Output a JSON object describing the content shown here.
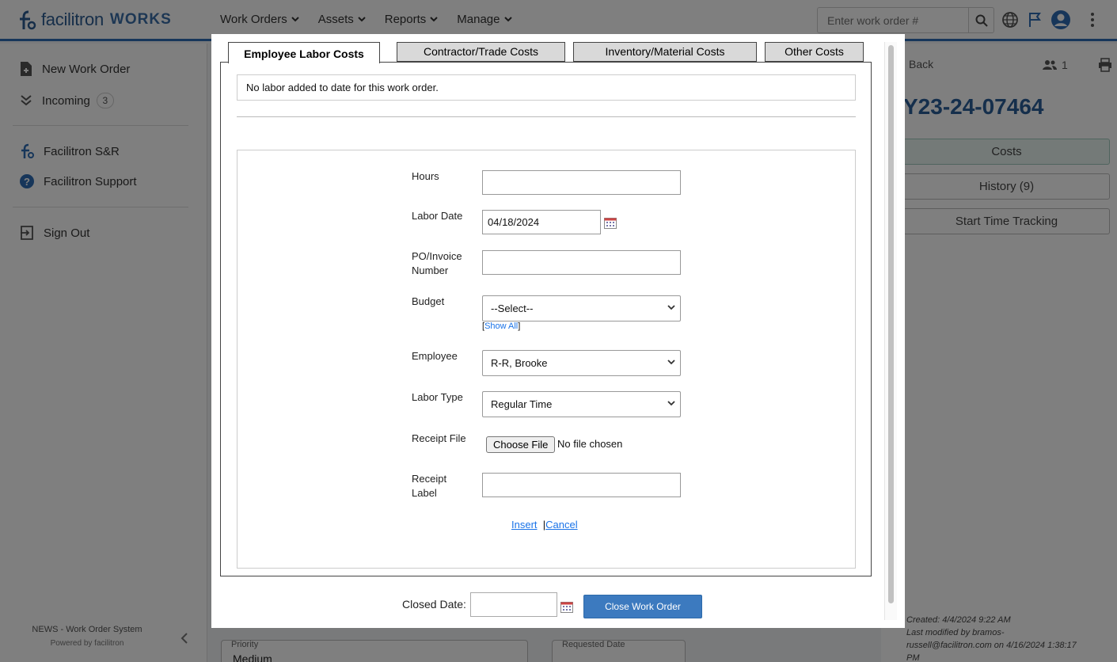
{
  "header": {
    "brand": "facilitron",
    "product": "WORKS",
    "nav": [
      {
        "label": "Work Orders"
      },
      {
        "label": "Assets"
      },
      {
        "label": "Reports"
      },
      {
        "label": "Manage"
      }
    ],
    "search_placeholder": "Enter work order #"
  },
  "sidebar": {
    "items": [
      {
        "label": "New Work Order",
        "icon": "new-file-icon"
      },
      {
        "label": "Incoming",
        "icon": "double-chevron-down-icon",
        "count": "3"
      },
      {
        "label": "Facilitron S&R",
        "icon": "facilitron-icon"
      },
      {
        "label": "Facilitron Support",
        "icon": "help-icon"
      },
      {
        "label": "Sign Out",
        "icon": "sign-out-icon"
      }
    ],
    "footer_system": "NEWS - Work Order System",
    "footer_powered": "Powered by",
    "footer_brand": "facilitron"
  },
  "right_panel": {
    "back_label": "Back",
    "user_count": "1",
    "work_order_id": "Y23-24-07464",
    "buttons": {
      "costs": "Costs",
      "history": "History (9)",
      "time_tracking": "Start Time Tracking"
    },
    "meta": {
      "created": "Created: 4/4/2024 9:22 AM",
      "modified_1": "Last modified by bramos-",
      "modified_2": "russell@facilitron.com on 4/16/2024 1:38:17",
      "modified_3": "PM"
    }
  },
  "background_fields": {
    "priority_label": "Priority",
    "priority_value": "Medium",
    "requested_label": "Requested Date"
  },
  "modal": {
    "tabs": [
      {
        "label": "Employee Labor Costs",
        "active": true
      },
      {
        "label": "Contractor/Trade Costs",
        "active": false
      },
      {
        "label": "Inventory/Material Costs",
        "active": false
      },
      {
        "label": "Other Costs",
        "active": false
      }
    ],
    "notice": "No labor added to date for this work order.",
    "form": {
      "hours_label": "Hours",
      "hours_value": "",
      "labor_date_label": "Labor Date",
      "labor_date_value": "04/18/2024",
      "po_label_1": "PO/Invoice",
      "po_label_2": "Number",
      "po_value": "",
      "budget_label": "Budget",
      "budget_value": "--Select--",
      "show_all": "Show All",
      "employee_label": "Employee",
      "employee_value": "R-R, Brooke",
      "labor_type_label": "Labor Type",
      "labor_type_value": "Regular Time",
      "receipt_file_label": "Receipt File",
      "choose_file": "Choose File",
      "no_file": "No file chosen",
      "receipt_label_1": "Receipt",
      "receipt_label_2": "Label",
      "receipt_label_value": "",
      "insert": "Insert",
      "cancel": "Cancel"
    },
    "closed_date_label": "Closed Date:",
    "closed_date_value": "",
    "close_button": "Close Work Order"
  }
}
